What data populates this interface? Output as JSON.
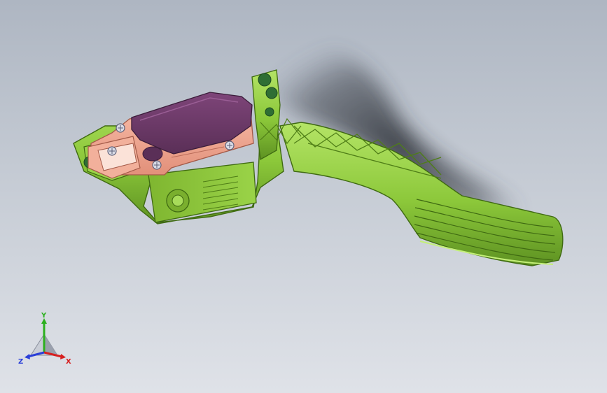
{
  "viewport": {
    "background_top": "#aeb6c2",
    "background_bottom": "#dfe2e8"
  },
  "model": {
    "housing_color": "#8cc83a",
    "housing_highlight": "#c3ef78",
    "housing_shadow": "#4f7e17",
    "sensor_color": "#f0a48e",
    "cover_color": "#6c3a6a",
    "screw_color": "#dadce6",
    "pin_color": "#2f6e34"
  },
  "triad": {
    "labels": {
      "y": "Y",
      "x": "X",
      "z": "Z"
    },
    "colors": {
      "y": "#2cb01e",
      "x": "#d62020",
      "z": "#2a3fd8"
    }
  }
}
